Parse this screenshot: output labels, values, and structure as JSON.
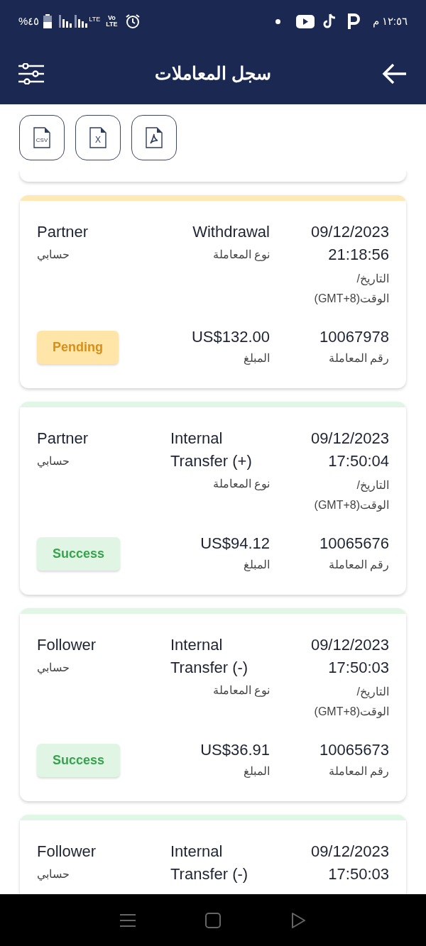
{
  "status_bar": {
    "time": "١٢:٥٦ م",
    "battery": "%٤٥",
    "lte_label": "LTE",
    "volte_top": "Vo",
    "volte_bottom": "LTE"
  },
  "header": {
    "title": "سجل المعاملات"
  },
  "export_buttons": [
    {
      "kind": "pdf"
    },
    {
      "kind": "excel",
      "label": "X"
    },
    {
      "kind": "csv",
      "label": "CSV"
    }
  ],
  "transactions": [
    {
      "date": "09/12/2023",
      "time": "21:18:56",
      "datetime_label": "التاريخ/ الوقت(GMT+8)",
      "type": "Withdrawal",
      "type_label": "نوع المعاملة",
      "account": "Partner",
      "account_label": "حسابي",
      "id": "10067978",
      "id_label": "رقم المعاملة",
      "amount": "US$132.00",
      "amount_label": "المبلغ",
      "status": {
        "text": "Pending",
        "kind": "pending"
      }
    },
    {
      "date": "09/12/2023",
      "time": "17:50:04",
      "datetime_label": "التاريخ/ الوقت(GMT+8)",
      "type": "Internal Transfer (+)",
      "type_label": "نوع المعاملة",
      "account": "Partner",
      "account_label": "حسابي",
      "id": "10065676",
      "id_label": "رقم المعاملة",
      "amount": "US$94.12",
      "amount_label": "المبلغ",
      "status": {
        "text": "Success",
        "kind": "success"
      }
    },
    {
      "date": "09/12/2023",
      "time": "17:50:03",
      "datetime_label": "التاريخ/ الوقت(GMT+8)",
      "type": "Internal Transfer (-)",
      "type_label": "نوع المعاملة",
      "account": "Follower",
      "account_label": "حسابي",
      "id": "10065673",
      "id_label": "رقم المعاملة",
      "amount": "US$36.91",
      "amount_label": "المبلغ",
      "status": {
        "text": "Success",
        "kind": "success"
      }
    },
    {
      "date": "09/12/2023",
      "time": "17:50:03",
      "type": "Internal Transfer (-)",
      "account": "Follower",
      "account_label": "حسابي",
      "status": {
        "kind": "success"
      }
    }
  ]
}
